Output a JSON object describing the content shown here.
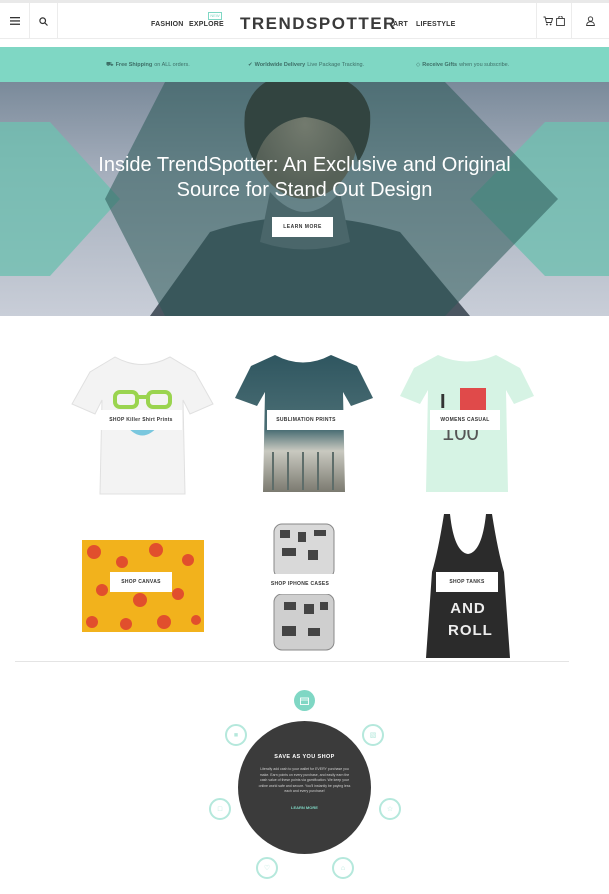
{
  "header": {
    "nav": {
      "fashion": "FASHION",
      "explore": "EXPLORE",
      "explore_badge": "NEW",
      "art": "ART",
      "lifestyle": "LIFESTYLE"
    },
    "logo": "TRENDSPOTTER"
  },
  "promo": {
    "shipping_bold": "Free Shipping",
    "shipping_rest": "on ALL orders.",
    "delivery_bold": "Worldwide Delivery",
    "delivery_rest": "Live Package Tracking.",
    "gifts_bold": "Receive Gifts",
    "gifts_rest": "when you subscribe."
  },
  "hero": {
    "title_line1": "Inside TrendSpotter: An Exclusive and Original",
    "title_line2": "Source for Stand Out Design",
    "button": "LEARN MORE"
  },
  "products": [
    {
      "label": "SHOP Killer Shirt Prints"
    },
    {
      "label": "SUBLIMATION PRINTS"
    },
    {
      "label": "WOMENS CASUAL"
    },
    {
      "label": "SHOP CANVAS"
    },
    {
      "label": "SHOP IPHONE CASES"
    },
    {
      "label": "SHOP TANKS",
      "tank_text": "AND ROLL"
    }
  ],
  "save": {
    "title": "SAVE AS YOU SHOP",
    "body": "Literally add cash to your wallet for EVERY purchase you make. Earn points on every purchase, and easily earn the cash value of these points via gamification. We keep your online world safe and secure. You'll instantly be paying less each and every purchase!",
    "link": "LEARN MORE"
  },
  "colors": {
    "accent": "#7fd7c4",
    "dark": "#3b3b3b"
  }
}
